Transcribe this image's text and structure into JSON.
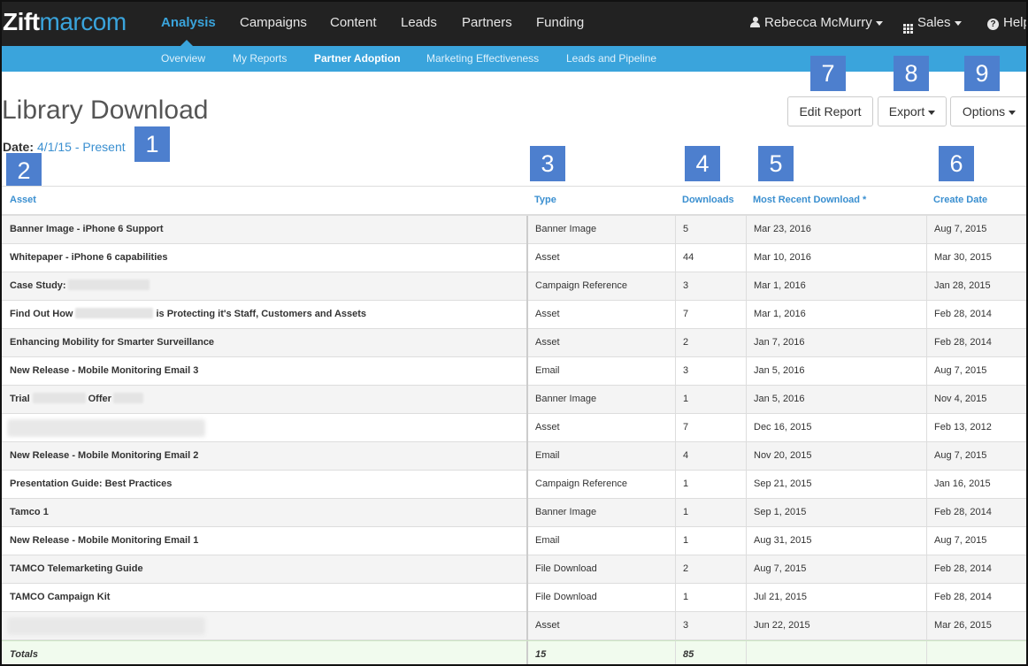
{
  "header": {
    "logo_part1": "Zift",
    "logo_part2": "marcom",
    "nav": [
      "Analysis",
      "Campaigns",
      "Content",
      "Leads",
      "Partners",
      "Funding"
    ],
    "active_nav": "Analysis",
    "user_name": "Rebecca McMurry",
    "role_menu": "Sales",
    "help": "Help"
  },
  "subnav": {
    "items": [
      "Overview",
      "My Reports",
      "Partner Adoption",
      "Marketing Effectiveness",
      "Leads and Pipeline"
    ],
    "active": "Partner Adoption"
  },
  "page": {
    "title": "Library Download",
    "date_label": "Date:",
    "date_value": "4/1/15 - Present"
  },
  "buttons": {
    "edit_report": "Edit Report",
    "export": "Export",
    "options": "Options"
  },
  "markers": [
    "1",
    "2",
    "3",
    "4",
    "5",
    "6",
    "7",
    "8",
    "9"
  ],
  "table": {
    "columns": {
      "asset": "Asset",
      "type": "Type",
      "downloads": "Downloads",
      "most_recent": "Most Recent Download *",
      "create_date": "Create Date"
    },
    "rows": [
      {
        "asset_parts": [
          "Banner Image - iPhone 6 Support"
        ],
        "type": "Banner Image",
        "downloads": "5",
        "most_recent": "Mar 23, 2016",
        "create_date": "Aug 7, 2015"
      },
      {
        "asset_parts": [
          "Whitepaper - iPhone 6 capabilities"
        ],
        "type": "Asset",
        "downloads": "44",
        "most_recent": "Mar 10, 2016",
        "create_date": "Mar 30, 2015"
      },
      {
        "asset_parts": [
          "Case Study:"
        ],
        "type": "Campaign Reference",
        "downloads": "3",
        "most_recent": "Mar 1, 2016",
        "create_date": "Jan 28, 2015"
      },
      {
        "asset_parts": [
          "Find Out How",
          "is Protecting it's Staff, Customers and Assets"
        ],
        "type": "Asset",
        "downloads": "7",
        "most_recent": "Mar 1, 2016",
        "create_date": "Feb 28, 2014"
      },
      {
        "asset_parts": [
          "Enhancing Mobility for Smarter Surveillance"
        ],
        "type": "Asset",
        "downloads": "2",
        "most_recent": "Jan 7, 2016",
        "create_date": "Feb 28, 2014"
      },
      {
        "asset_parts": [
          "New Release - Mobile Monitoring Email 3"
        ],
        "type": "Email",
        "downloads": "3",
        "most_recent": "Jan 5, 2016",
        "create_date": "Aug 7, 2015"
      },
      {
        "asset_parts": [
          "Trial",
          "Offer"
        ],
        "type": "Banner Image",
        "downloads": "1",
        "most_recent": "Jan 5, 2016",
        "create_date": "Nov 4, 2015"
      },
      {
        "asset_parts": [],
        "type": "Asset",
        "downloads": "7",
        "most_recent": "Dec 16, 2015",
        "create_date": "Feb 13, 2012"
      },
      {
        "asset_parts": [
          "New Release - Mobile Monitoring Email 2"
        ],
        "type": "Email",
        "downloads": "4",
        "most_recent": "Nov 20, 2015",
        "create_date": "Aug 7, 2015"
      },
      {
        "asset_parts": [
          "Presentation Guide: Best Practices"
        ],
        "type": "Campaign Reference",
        "downloads": "1",
        "most_recent": "Sep 21, 2015",
        "create_date": "Jan 16, 2015"
      },
      {
        "asset_parts": [
          "Tamco 1"
        ],
        "type": "Banner Image",
        "downloads": "1",
        "most_recent": "Sep 1, 2015",
        "create_date": "Feb 28, 2014"
      },
      {
        "asset_parts": [
          "New Release - Mobile Monitoring Email 1"
        ],
        "type": "Email",
        "downloads": "1",
        "most_recent": "Aug 31, 2015",
        "create_date": "Aug 7, 2015"
      },
      {
        "asset_parts": [
          "TAMCO Telemarketing Guide"
        ],
        "type": "File Download",
        "downloads": "2",
        "most_recent": "Aug 7, 2015",
        "create_date": "Feb 28, 2014"
      },
      {
        "asset_parts": [
          "TAMCO Campaign Kit"
        ],
        "type": "File Download",
        "downloads": "1",
        "most_recent": "Jul 21, 2015",
        "create_date": "Feb 28, 2014"
      },
      {
        "asset_parts": [],
        "type": "Asset",
        "downloads": "3",
        "most_recent": "Jun 22, 2015",
        "create_date": "Mar 26, 2015"
      }
    ],
    "totals": {
      "label": "Totals",
      "type": "15",
      "downloads": "85"
    }
  }
}
